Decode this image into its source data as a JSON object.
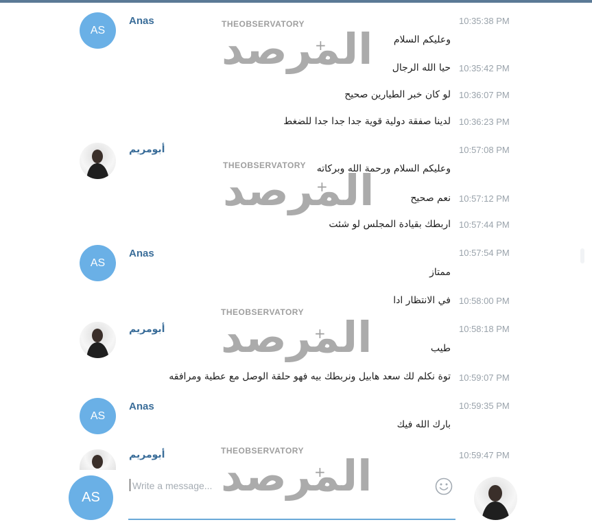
{
  "messages": [
    {
      "sender": "Anas",
      "time": "10:35:38 PM",
      "text": "وعليكم السلام"
    },
    {
      "time": "10:35:42 PM",
      "text": "حيا الله الرجال"
    },
    {
      "time": "10:36:07 PM",
      "text": "لو كان خبر الطيارين صحيح"
    },
    {
      "time": "10:36:23 PM",
      "text": "لدينا صفقة دولية قوية جدا جدا جدا للضغط"
    },
    {
      "sender": "أبومريم",
      "time": "10:57:08 PM",
      "text": "وعليكم السلام ورحمة الله وبركاته"
    },
    {
      "time": "10:57:12 PM",
      "text": "نعم صحيح"
    },
    {
      "time": "10:57:44 PM",
      "text": "اربطك بقيادة المجلس لو شئت"
    },
    {
      "sender": "Anas",
      "time": "10:57:54 PM",
      "text": "ممتاز"
    },
    {
      "time": "10:58:00 PM",
      "text": "في الانتظار ادا"
    },
    {
      "sender": "أبومريم",
      "time": "10:58:18 PM",
      "text": "طيب"
    },
    {
      "time": "10:59:07 PM",
      "text": "توة نكلم لك سعد هابيل ونربطك بيه فهو حلقة الوصل مع عطية ومرافقه"
    },
    {
      "sender": "Anas",
      "time": "10:59:35 PM",
      "text": "بارك الله فيك"
    },
    {
      "sender": "أبومريم",
      "time": "10:59:47 PM",
      "text": ""
    }
  ],
  "avatar_initials": "AS",
  "composer": {
    "placeholder": "Write a message..."
  },
  "watermark": {
    "top": "THEOBSERVATORY",
    "main": "المرصد"
  },
  "colors": {
    "accent": "#6ab0e6",
    "sender": "#3a6d99",
    "timestamp": "#9aa3ab",
    "topbar": "#5b7a96"
  },
  "icons": {
    "emoji": "smiley-icon"
  }
}
